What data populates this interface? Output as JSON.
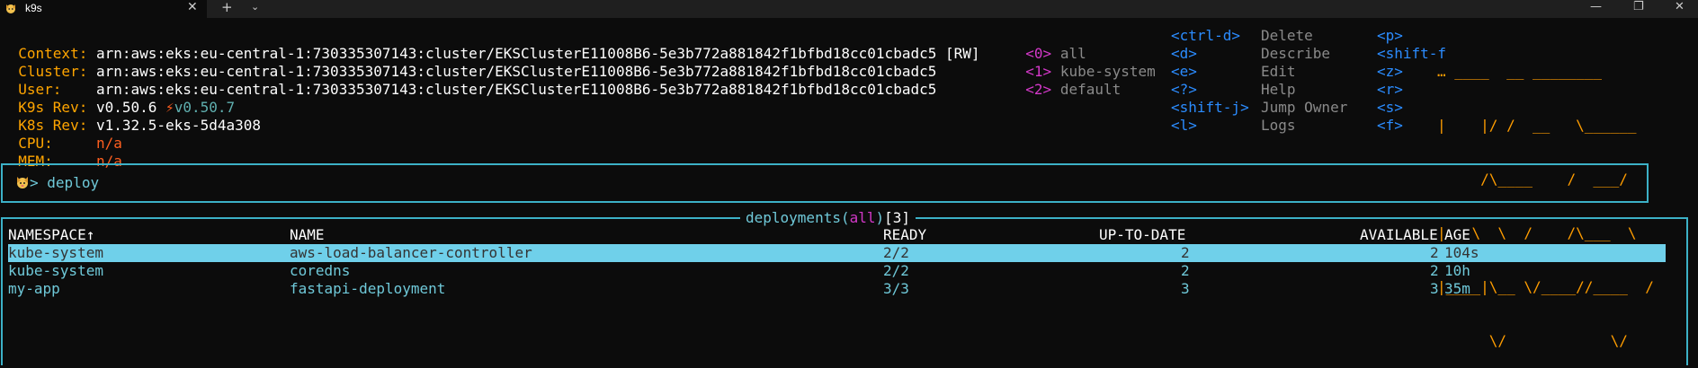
{
  "tabbar": {
    "tab_title": "k9s",
    "tab_icon": "k9s-dog-icon",
    "close_glyph": "✕",
    "new_tab_glyph": "+",
    "dropdown_glyph": "⌄",
    "minimize_glyph": "—",
    "maximize_glyph": "❐",
    "close_window_glyph": "✕"
  },
  "info": {
    "context_label": "Context:",
    "context_value": "arn:aws:eks:eu-central-1:730335307143:cluster/EKSClusterE11008B6-5e3b772a881842f1bfbd18cc01cbadc5",
    "context_mode": "[RW]",
    "cluster_label": "Cluster:",
    "cluster_value": "arn:aws:eks:eu-central-1:730335307143:cluster/EKSClusterE11008B6-5e3b772a881842f1bfbd18cc01cbadc5",
    "user_label": "User:",
    "user_value": "arn:aws:eks:eu-central-1:730335307143:cluster/EKSClusterE11008B6-5e3b772a881842f1bfbd18cc01cbadc5",
    "k9s_rev_label": "K9s Rev:",
    "k9s_rev_value": "v0.50.6",
    "k9s_rev_upgrade_glyph": "⚡",
    "k9s_rev_upgrade": "v0.50.7",
    "k8s_rev_label": "K8s Rev:",
    "k8s_rev_value": "v1.32.5-eks-5d4a308",
    "cpu_label": "CPU:",
    "cpu_value": "n/a",
    "mem_label": "MEM:",
    "mem_value": "n/a"
  },
  "namespaces": [
    {
      "key": "<0>",
      "name": "all"
    },
    {
      "key": "<1>",
      "name": "kube-system"
    },
    {
      "key": "<2>",
      "name": "default"
    }
  ],
  "shortcuts": [
    {
      "key": "<ctrl-d>",
      "label": "Delete"
    },
    {
      "key": "<d>",
      "label": "Describe"
    },
    {
      "key": "<e>",
      "label": "Edit"
    },
    {
      "key": "<?>",
      "label": "Help"
    },
    {
      "key": "<shift-j>",
      "label": "Jump Owner"
    },
    {
      "key": "<l>",
      "label": "Logs"
    }
  ],
  "shortcuts2": [
    {
      "key": "<p>"
    },
    {
      "key": "<shift-f"
    },
    {
      "key": "<z>"
    },
    {
      "key": "<r>"
    },
    {
      "key": "<s>"
    },
    {
      "key": "<f>"
    }
  ],
  "logo_lines": [
    "… ____  __ ________",
    "|    |/ /  __   \\______",
    "     /\\____    /  ___/",
    "|   \\  \\  /    /\\___  \\",
    "|____|\\__ \\/____//____  /",
    "      \\/            \\/"
  ],
  "command": {
    "icon": "dog-icon",
    "prompt": ">",
    "text": "deploy"
  },
  "table": {
    "title_resource": "deployments",
    "title_open": "(",
    "title_ns": "all",
    "title_close": ")",
    "title_count": "[3]",
    "headers": {
      "namespace": "NAMESPACE↑",
      "name": "NAME",
      "ready": "READY",
      "uptodate": "UP-TO-DATE",
      "available": "AVAILABLE",
      "age": "AGE"
    },
    "rows": [
      {
        "namespace": "kube-system",
        "name": "aws-load-balancer-controller",
        "ready": "2/2",
        "uptodate": "2",
        "available": "2",
        "age": "104s"
      },
      {
        "namespace": "kube-system",
        "name": "coredns",
        "ready": "2/2",
        "uptodate": "2",
        "available": "2",
        "age": "10h"
      },
      {
        "namespace": "my-app",
        "name": "fastapi-deployment",
        "ready": "3/3",
        "uptodate": "3",
        "available": "3",
        "age": "35m"
      }
    ]
  },
  "colors": {
    "background": "#0c0c0c",
    "label": "#ffa500",
    "accent_cyan": "#6fc9d9",
    "border": "#3cb1c7",
    "selected_row": "#6fd0ea",
    "key_blue": "#2b8cff",
    "key_magenta": "#d338c8"
  }
}
